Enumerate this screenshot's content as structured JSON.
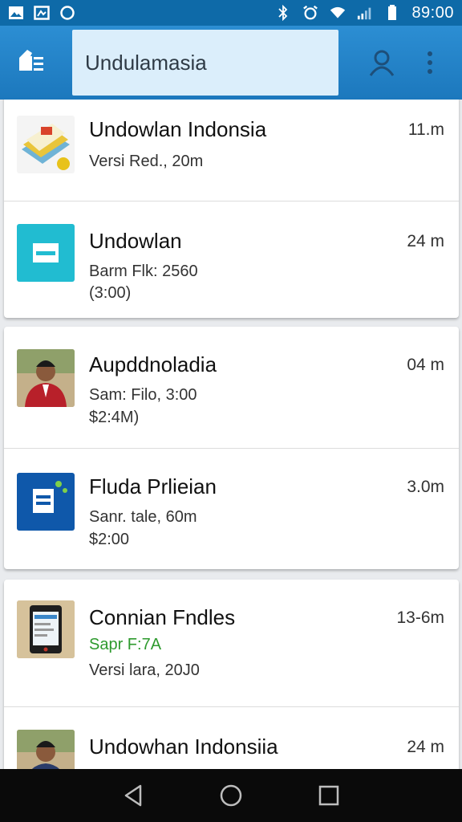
{
  "status_bar": {
    "time": "89:00",
    "icons_left": [
      "image-icon",
      "gallery-icon",
      "sync-icon"
    ],
    "icons_right": [
      "bluetooth-icon",
      "alarm-icon",
      "wifi-icon",
      "signal-icon",
      "battery-icon"
    ]
  },
  "app_bar": {
    "search_value": "Undulamasia",
    "actions": [
      "account-icon",
      "more-vert-icon"
    ],
    "colors": {
      "primary": "#1c78bd",
      "search_bg": "#dbeefb"
    }
  },
  "list": {
    "items": [
      {
        "title": "Undowlan Indonsia",
        "subtitle": "Versi Red., 20m",
        "size": "11.m",
        "thumb": "book-stack-icon"
      },
      {
        "title": "Undowlan",
        "subtitle": "Barm Flk: 2560",
        "meta": "(3:00)",
        "size": "24 m",
        "thumb": "teal-app-icon"
      },
      {
        "title": "Aupddnoladia",
        "subtitle": "Sam: Filo, 3:00",
        "meta": "$2:4M)",
        "size": "04 m",
        "thumb": "person-photo"
      },
      {
        "title": "Fluda Prlieian",
        "subtitle": "Sanr. tale, 60m",
        "meta": "$2:00",
        "size": "3.0m",
        "thumb": "blue-app-icon"
      },
      {
        "title": "Connian Fndles",
        "subtitle": "Sapr F:7A",
        "meta": "Versi lara, 20J0",
        "size": "13-6m",
        "thumb": "phone-icon"
      },
      {
        "title": "Undowhan Indonsiia",
        "subtitle": "",
        "size": "24 m",
        "thumb": "person-photo-2"
      }
    ]
  },
  "nav_bar": {
    "buttons": [
      "back-icon",
      "home-icon",
      "recents-icon"
    ]
  }
}
